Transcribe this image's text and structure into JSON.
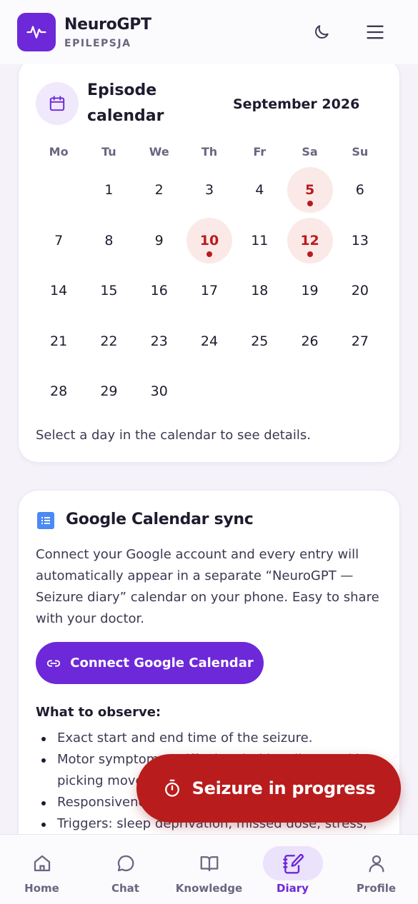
{
  "app": {
    "name": "NeuroGPT",
    "subtitle": "EPILEPSJA"
  },
  "colors": {
    "accent": "#6d28d9",
    "danger": "#b91c1c",
    "episode_bg": "#fbe9e8"
  },
  "calendar": {
    "title": "Episode calendar",
    "month": "September 2026",
    "weekdays": [
      "Mo",
      "Tu",
      "We",
      "Th",
      "Fr",
      "Sa",
      "Su"
    ],
    "days": [
      "",
      "1",
      "2",
      "3",
      "4",
      "5",
      "6",
      "7",
      "8",
      "9",
      "10",
      "11",
      "12",
      "13",
      "14",
      "15",
      "16",
      "17",
      "18",
      "19",
      "20",
      "21",
      "22",
      "23",
      "24",
      "25",
      "26",
      "27",
      "28",
      "29",
      "30",
      "",
      "",
      "",
      ""
    ],
    "episode_days": [
      "5",
      "10",
      "12"
    ],
    "hint": "Select a day in the calendar to see details."
  },
  "google_sync": {
    "title": "Google Calendar sync",
    "description": "Connect your Google account and every entry will automatically appear in a separate “NeuroGPT — Seizure diary” calendar on your phone. Easy to share with your doctor.",
    "button_label": "Connect Google Calendar",
    "observe_title": "What to observe:",
    "observe_items": [
      "Exact start and end time of the seizure.",
      "Motor symptoms: stiffening, jerking, lip smacking, picking movements.",
      "Responsiveness during and after the episode.",
      "Triggers: sleep deprivation, missed dose, stress, alcohol."
    ]
  },
  "fab": {
    "label": "Seizure in progress",
    "icon": "stopwatch-icon"
  },
  "nav": {
    "items": [
      {
        "label": "Home",
        "icon": "home-icon"
      },
      {
        "label": "Chat",
        "icon": "chat-icon"
      },
      {
        "label": "Knowledge",
        "icon": "book-icon"
      },
      {
        "label": "Diary",
        "icon": "notebook-pen-icon",
        "active": true
      },
      {
        "label": "Profile",
        "icon": "user-icon"
      }
    ]
  }
}
